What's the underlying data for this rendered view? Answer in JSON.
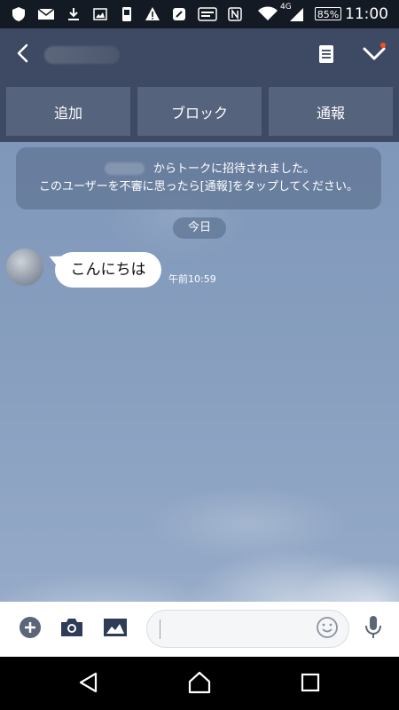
{
  "status_bar": {
    "network_label": "4G",
    "battery": "85%",
    "time": "11:00"
  },
  "header": {
    "back_icon": "chevron-left-icon",
    "note_icon": "note-icon",
    "check_icon": "check-icon",
    "notification_dot_color": "#ff4b1f"
  },
  "actions": {
    "add_label": "追加",
    "block_label": "ブロック",
    "report_label": "通報"
  },
  "chat": {
    "system_message": {
      "line1": "からトークに招待されました。",
      "line2": "このユーザーを不審に思ったら[通報]をタップしてください。"
    },
    "date_label": "今日",
    "messages": [
      {
        "text": "こんにちは",
        "time": "午前10:59"
      }
    ]
  },
  "input_bar": {
    "plus_icon": "plus-circle-icon",
    "camera_icon": "camera-icon",
    "image_icon": "image-icon",
    "emoji_icon": "emoji-icon",
    "mic_icon": "microphone-icon",
    "message_value": "",
    "message_placeholder": ""
  },
  "colors": {
    "header_bg": "#3e4a63",
    "action_button_bg": "#56637c",
    "chat_bg": "#889fbf",
    "bubble_bg": "#ffffff"
  }
}
